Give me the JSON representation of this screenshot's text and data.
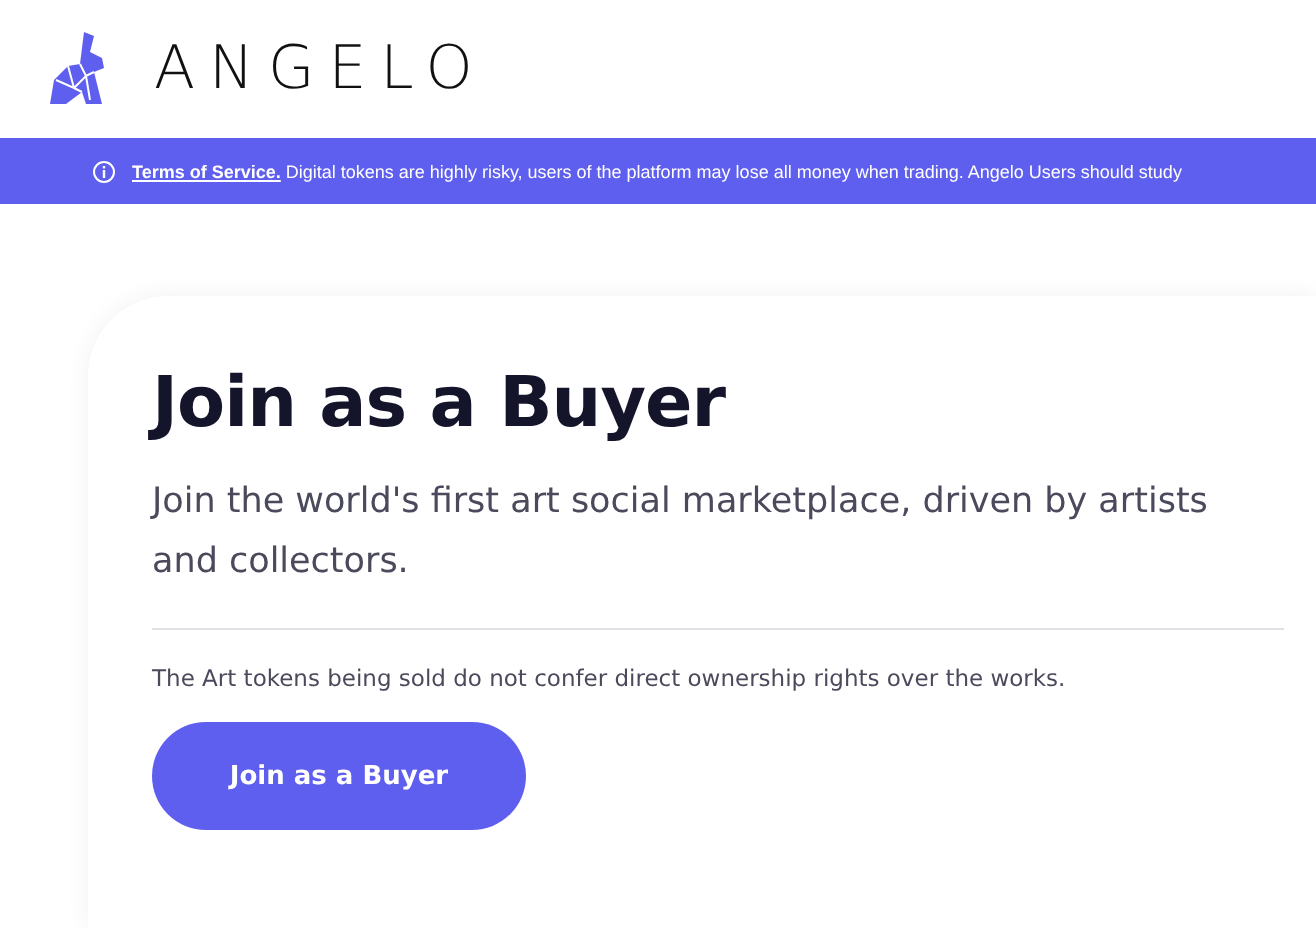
{
  "header": {
    "logo_text": "ANGELO"
  },
  "banner": {
    "link": "Terms of Service.",
    "text": "Digital tokens are highly risky, users of the platform may lose all money when trading. Angelo Users should study"
  },
  "card": {
    "title": "Join as a Buyer",
    "subtitle": "Join the world's first art social marketplace, driven by artists and collectors.",
    "note": "The Art tokens being sold do not confer direct ownership rights over the works.",
    "button": "Join as a Buyer"
  }
}
